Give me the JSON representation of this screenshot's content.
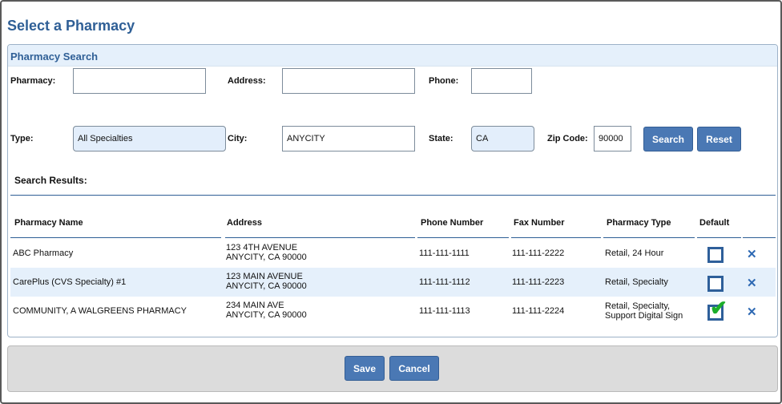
{
  "page": {
    "title": "Select a Pharmacy"
  },
  "search": {
    "header": "Pharmacy Search",
    "pharmacy_label": "Pharmacy:",
    "pharmacy_value": "",
    "address_label": "Address:",
    "address_value": "",
    "phone_label": "Phone:",
    "phone_value": "",
    "type_label": "Type:",
    "type_value": "All Specialties",
    "city_label": "City:",
    "city_value": "ANYCITY",
    "state_label": "State:",
    "state_value": "CA",
    "zip_label": "Zip Code:",
    "zip_value": "90000",
    "search_button": "Search",
    "reset_button": "Reset"
  },
  "results": {
    "label": "Search Results:",
    "columns": [
      "Pharmacy Name",
      "Address",
      "Phone Number",
      "Fax Number",
      "Pharmacy Type",
      "Default"
    ],
    "rows": [
      {
        "name": "ABC Pharmacy",
        "address": [
          "123 4TH AVENUE",
          "ANYCITY, CA 90000"
        ],
        "phone": "111-111-1111",
        "fax": "111-111-2222",
        "type": [
          "Retail, 24 Hour"
        ],
        "default": false
      },
      {
        "name": "CarePlus (CVS Specialty) #1",
        "address": [
          "123 MAIN AVENUE",
          "ANYCITY, CA 90000"
        ],
        "phone": "111-111-1112",
        "fax": "111-111-2223",
        "type": [
          "Retail, Specialty"
        ],
        "default": false
      },
      {
        "name": "COMMUNITY, A WALGREENS PHARMACY",
        "address": [
          "234 MAIN AVE",
          "ANYCITY, CA 90000"
        ],
        "phone": "111-111-1113",
        "fax": "111-111-2224",
        "type": [
          "Retail, Specialty,",
          "Support Digital Sign"
        ],
        "default": true
      }
    ],
    "delete_icon": "close-icon",
    "check_glyph": "✔"
  },
  "footer": {
    "save_button": "Save",
    "cancel_button": "Cancel"
  },
  "colors": {
    "accent": "#2f5f96",
    "button": "#4a78b4",
    "row_alt": "#e5f0fb",
    "check": "#1cae2a"
  }
}
